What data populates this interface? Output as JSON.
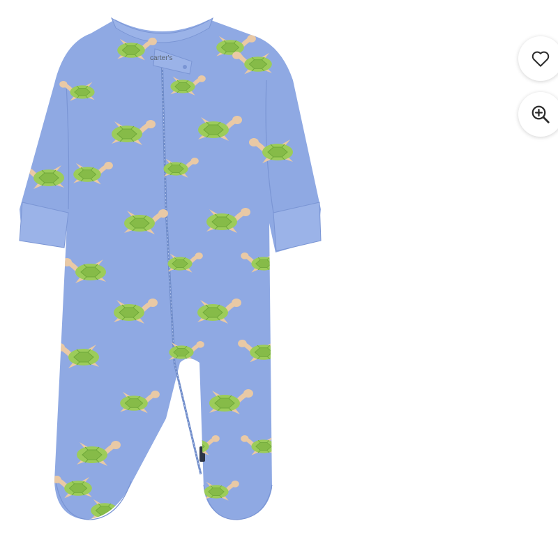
{
  "product": {
    "brand_tag": "carter's",
    "colors": {
      "fabric": "#8fa9e3",
      "fabric_dark": "#7a95d4",
      "cuff": "#9bb3e8",
      "shell": "#9ccc5a",
      "shell_dark": "#6fa83a",
      "skin": "#e9c9a5"
    }
  },
  "actions": {
    "favorite_icon": "heart-icon",
    "zoom_icon": "zoom-in-icon"
  }
}
